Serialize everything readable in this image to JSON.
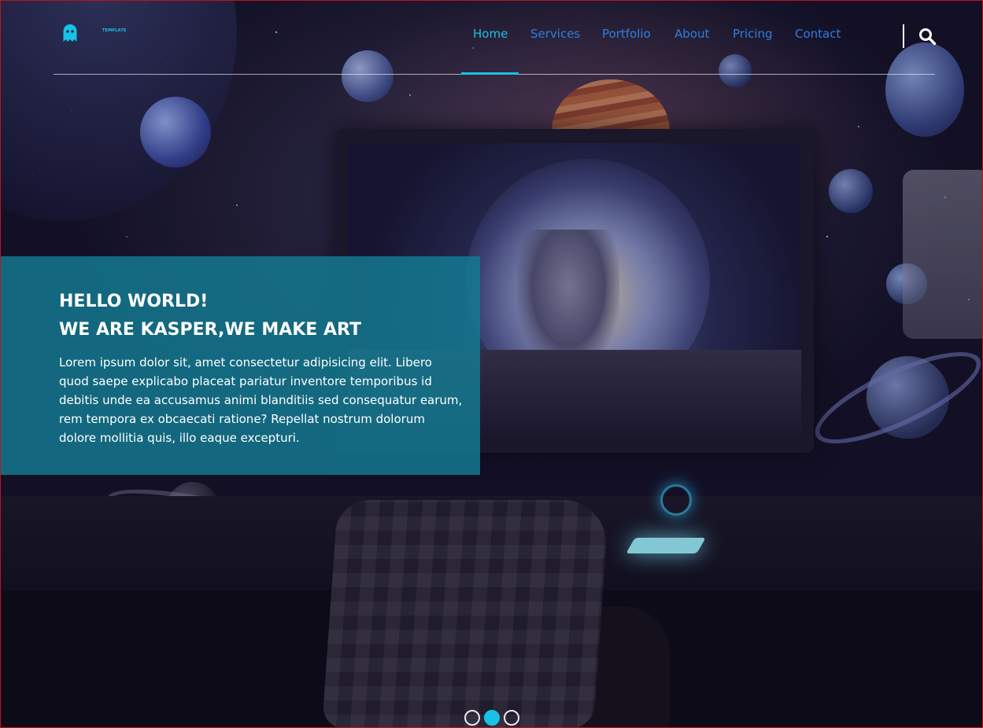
{
  "logo": {
    "text": "TEMPLATE",
    "icon": "ghost-icon"
  },
  "nav": {
    "items": [
      {
        "label": "Home",
        "active": true
      },
      {
        "label": "Services",
        "active": false
      },
      {
        "label": "Portfolio",
        "active": false
      },
      {
        "label": "About",
        "active": false
      },
      {
        "label": "Pricing",
        "active": false
      },
      {
        "label": "Contact",
        "active": false
      }
    ],
    "search_icon": "search-icon"
  },
  "intro": {
    "line1": "HELLO WORLD!",
    "line2": "WE ARE KASPER,WE MAKE ART",
    "body": "Lorem ipsum dolor sit, amet consectetur adipisicing elit. Libero quod saepe explicabo placeat pariatur inventore temporibus id debitis unde ea accusamus animi blanditiis sed consequatur earum, rem tempora ex obcaecati ratione? Repellat nostrum dolorum dolore mollitia quis, illo eaque excepturi."
  },
  "slider": {
    "total": 3,
    "active_index": 1
  },
  "colors": {
    "accent": "#19c1e6",
    "nav_link": "#2e7ee0",
    "intro_bg": "#137d94"
  }
}
